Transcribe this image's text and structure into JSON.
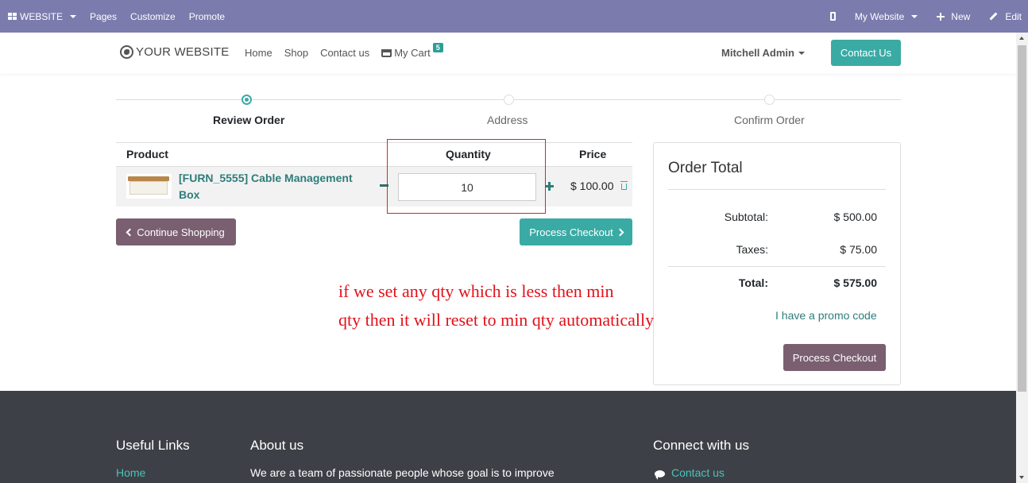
{
  "adminbar": {
    "website_label": "WEBSITE",
    "menu": [
      "Pages",
      "Customize",
      "Promote"
    ],
    "site_label": "My Website",
    "new_label": "New",
    "edit_label": "Edit"
  },
  "navbar": {
    "logo_text": "YOUR WEBSITE",
    "links": [
      "Home",
      "Shop",
      "Contact us"
    ],
    "cart_label": "My Cart",
    "cart_count": "5",
    "user_name": "Mitchell Admin",
    "contact_button": "Contact Us"
  },
  "wizard": {
    "steps": [
      "Review Order",
      "Address",
      "Confirm Order"
    ],
    "active_step": 0
  },
  "cart_table": {
    "headers": [
      "Product",
      "Quantity",
      "Price"
    ],
    "rows": [
      {
        "name": "[FURN_5555] Cable Management Box",
        "quantity": "10",
        "price": "$ 100.00"
      }
    ]
  },
  "buttons": {
    "continue": "Continue Shopping",
    "process": "Process Checkout"
  },
  "order_total": {
    "title": "Order Total",
    "subtotal_label": "Subtotal:",
    "subtotal_value": "$ 500.00",
    "taxes_label": "Taxes:",
    "taxes_value": "$ 75.00",
    "total_label": "Total:",
    "total_value": "$ 575.00",
    "promo": "I have a promo code",
    "process": "Process Checkout"
  },
  "annotation": {
    "line1": "if we set any qty which is less then min",
    "line2": "qty then it will reset to min qty automatically"
  },
  "footer": {
    "useful_links_title": "Useful Links",
    "useful_first": "Home",
    "about_title": "About us",
    "about_text": "We are a team of passionate people whose goal is to improve",
    "connect_title": "Connect with us",
    "connect_first": "Contact us"
  },
  "colors": {
    "admin_bar": "#7c7bad",
    "accent": "#3aaaa5",
    "secondary": "#7a5f71",
    "annotation": "#e1121a",
    "footer": "#3d4046"
  }
}
